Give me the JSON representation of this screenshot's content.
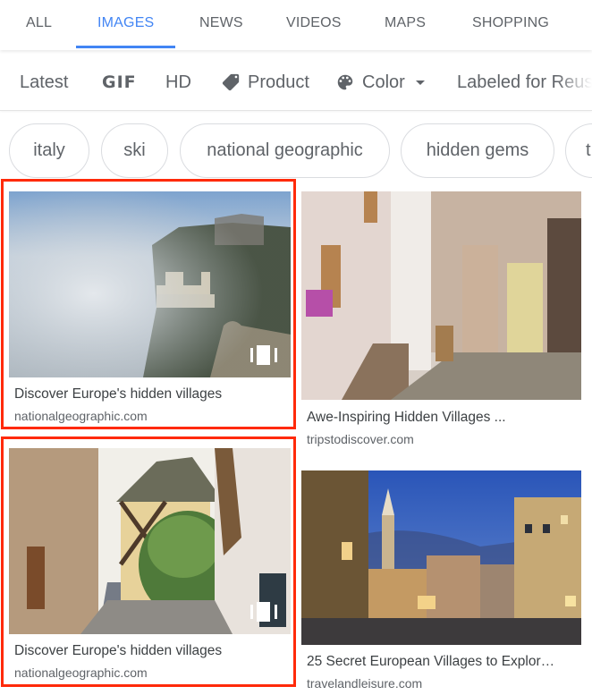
{
  "nav": {
    "tabs": [
      {
        "label": "ALL",
        "active": false
      },
      {
        "label": "IMAGES",
        "active": true
      },
      {
        "label": "NEWS",
        "active": false
      },
      {
        "label": "VIDEOS",
        "active": false
      },
      {
        "label": "MAPS",
        "active": false
      },
      {
        "label": "SHOPPING",
        "active": false
      }
    ],
    "accent_color": "#4285f4"
  },
  "filters": {
    "latest": "Latest",
    "gif": "GIF",
    "hd": "HD",
    "product": {
      "label": "Product",
      "icon": "tag-icon"
    },
    "color": {
      "label": "Color",
      "icon": "palette-icon",
      "dropdown_icon": "caret-down-icon"
    },
    "labeled_for_reuse": "Labeled for Reuse"
  },
  "chips": [
    "italy",
    "ski",
    "national geographic",
    "hidden gems",
    "t"
  ],
  "results": [
    {
      "title": "Discover Europe's hidden villages",
      "source": "nationalgeographic.com",
      "highlighted": true,
      "gallery": true,
      "scene": "foggy cliff with castle towers"
    },
    {
      "title": "Awe-Inspiring Hidden Villages ...",
      "source": "tripstodiscover.com",
      "highlighted": false,
      "gallery": false,
      "scene": "half-timbered cobblestone street"
    },
    {
      "title": "Discover Europe's hidden villages",
      "source": "nationalgeographic.com",
      "highlighted": true,
      "gallery": true,
      "scene": "village street with flowered house"
    },
    {
      "title": "25 Secret European Villages to Explor…",
      "source": "travelandleisure.com",
      "highlighted": false,
      "gallery": false,
      "scene": "town square at dusk"
    }
  ],
  "highlight_color": "#ff2a0a"
}
